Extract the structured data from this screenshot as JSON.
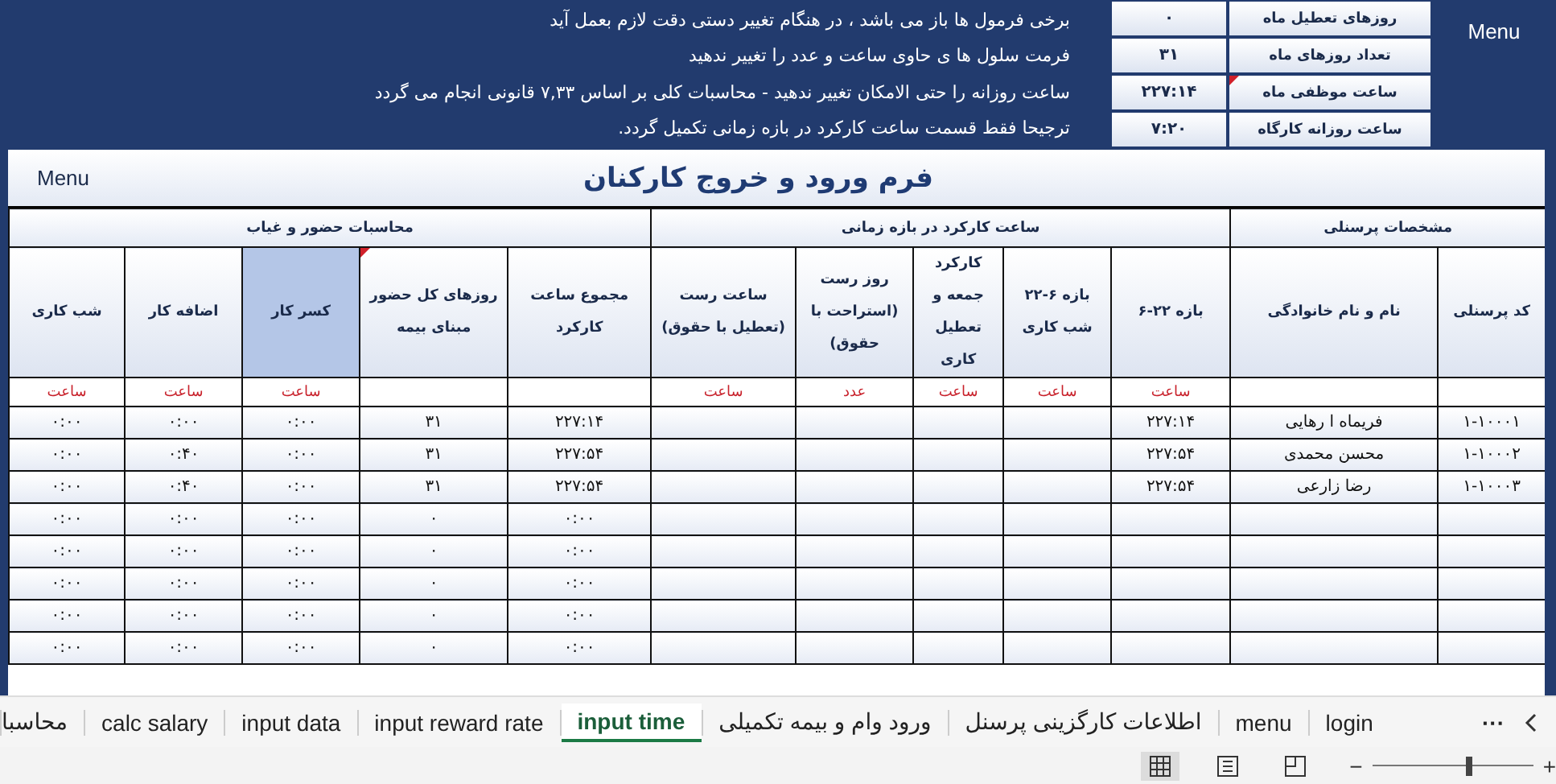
{
  "notes": [
    "برخی فرمول ها باز می باشد ، در هنگام تغییر دستی دقت لازم بعمل آید",
    "فرمت سلول ها ی حاوی ساعت و عدد را تغییر ندهید",
    "ساعت روزانه را حتی الامکان تغییر ندهید - محاسبات کلی بر اساس ۷,۳۳ قانونی انجام می گردد",
    "ترجیحا فقط قسمت ساعت کارکرد در بازه زمانی تکمیل گردد."
  ],
  "month_info": [
    {
      "label": "روزهای تعطیل ماه",
      "value": "۰",
      "comment": false
    },
    {
      "label": "تعداد روزهای ماه",
      "value": "۳۱",
      "comment": false
    },
    {
      "label": "ساعت موظفی ماه",
      "value": "۲۲۷:۱۴",
      "comment": true
    },
    {
      "label": "ساعت روزانه کارگاه",
      "value": "۷:۲۰",
      "comment": false
    }
  ],
  "top_menu": "Menu",
  "sheet": {
    "menu": "Menu",
    "title": "فرم ورود و خروج کارکنان",
    "groups": [
      {
        "label": "مشخصات پرسنلی",
        "columns": [
          {
            "header": "کد پرسنلی",
            "selected": false,
            "comment": false
          },
          {
            "header": "نام و نام خانوادگی",
            "selected": false,
            "comment": false
          }
        ]
      },
      {
        "label": "ساعت کارکرد در بازه زمانی",
        "columns": [
          {
            "header": "بازه ۲۲-۶",
            "unit": "ساعت",
            "selected": false,
            "comment": false
          },
          {
            "header": "بازه ۶-۲۲ شب کاری",
            "unit": "ساعت",
            "selected": false,
            "comment": false
          },
          {
            "header": "کارکرد جمعه و تعطیل کاری",
            "unit": "ساعت",
            "selected": false,
            "comment": false
          },
          {
            "header": "روز رست (استراحت با حقوق)",
            "unit": "عدد",
            "selected": false,
            "comment": false
          },
          {
            "header": "ساعت رست (تعطیل با حقوق)",
            "unit": "ساعت",
            "selected": false,
            "comment": false
          }
        ]
      },
      {
        "label": "محاسبات حضور و غیاب",
        "columns": [
          {
            "header": "مجموع ساعت کارکرد",
            "selected": false,
            "comment": false
          },
          {
            "header": "روزهای کل حضور مبنای بیمه",
            "selected": false,
            "comment": true
          },
          {
            "header": "کسر کار",
            "unit": "ساعت",
            "selected": true,
            "comment": false
          },
          {
            "header": "اضافه کار",
            "unit": "ساعت",
            "selected": false,
            "comment": false
          },
          {
            "header": "شب کاری",
            "unit": "ساعت",
            "selected": false,
            "comment": false
          }
        ]
      }
    ],
    "rows": [
      {
        "code": "۱-۱۰۰۰۱",
        "name": "فریماه ا رهایی",
        "r226": "۲۲۷:۱۴",
        "total": "۲۲۷:۱۴",
        "days": "۳۱",
        "deficit": "۰:۰۰",
        "overtime": "۰:۰۰",
        "night": "۰:۰۰"
      },
      {
        "code": "۱-۱۰۰۰۲",
        "name": "محسن محمدی",
        "r226": "۲۲۷:۵۴",
        "total": "۲۲۷:۵۴",
        "days": "۳۱",
        "deficit": "۰:۰۰",
        "overtime": "۰:۴۰",
        "night": "۰:۰۰"
      },
      {
        "code": "۱-۱۰۰۰۳",
        "name": "رضا زارعی",
        "r226": "۲۲۷:۵۴",
        "total": "۲۲۷:۵۴",
        "days": "۳۱",
        "deficit": "۰:۰۰",
        "overtime": "۰:۴۰",
        "night": "۰:۰۰"
      },
      {
        "total": "۰:۰۰",
        "days": "۰",
        "deficit": "۰:۰۰",
        "overtime": "۰:۰۰",
        "night": "۰:۰۰"
      },
      {
        "total": "۰:۰۰",
        "days": "۰",
        "deficit": "۰:۰۰",
        "overtime": "۰:۰۰",
        "night": "۰:۰۰"
      },
      {
        "total": "۰:۰۰",
        "days": "۰",
        "deficit": "۰:۰۰",
        "overtime": "۰:۰۰",
        "night": "۰:۰۰"
      },
      {
        "total": "۰:۰۰",
        "days": "۰",
        "deficit": "۰:۰۰",
        "overtime": "۰:۰۰",
        "night": "۰:۰۰"
      },
      {
        "total": "۰:۰۰",
        "days": "۰",
        "deficit": "۰:۰۰",
        "overtime": "۰:۰۰",
        "night": "۰:۰۰"
      }
    ]
  },
  "sheet_tabs": [
    {
      "label": "login",
      "selected": false
    },
    {
      "label": "menu",
      "selected": false
    },
    {
      "label": "اطلاعات کارگزینی پرسنل",
      "selected": false
    },
    {
      "label": "ورود وام و بیمه تکمیلی",
      "selected": false
    },
    {
      "label": "input time",
      "selected": true
    },
    {
      "label": "input reward rate",
      "selected": false
    },
    {
      "label": "input data",
      "selected": false
    },
    {
      "label": "calc salary",
      "selected": false
    },
    {
      "label": "محاسبا",
      "selected": false
    }
  ],
  "tab_overflow": "···",
  "views": [
    {
      "kind": "normal",
      "selected": true
    },
    {
      "kind": "layout",
      "selected": false
    },
    {
      "kind": "pagebreak",
      "selected": false
    }
  ],
  "zoom": {
    "minus": "−",
    "plus": "+",
    "level": 0.6
  }
}
